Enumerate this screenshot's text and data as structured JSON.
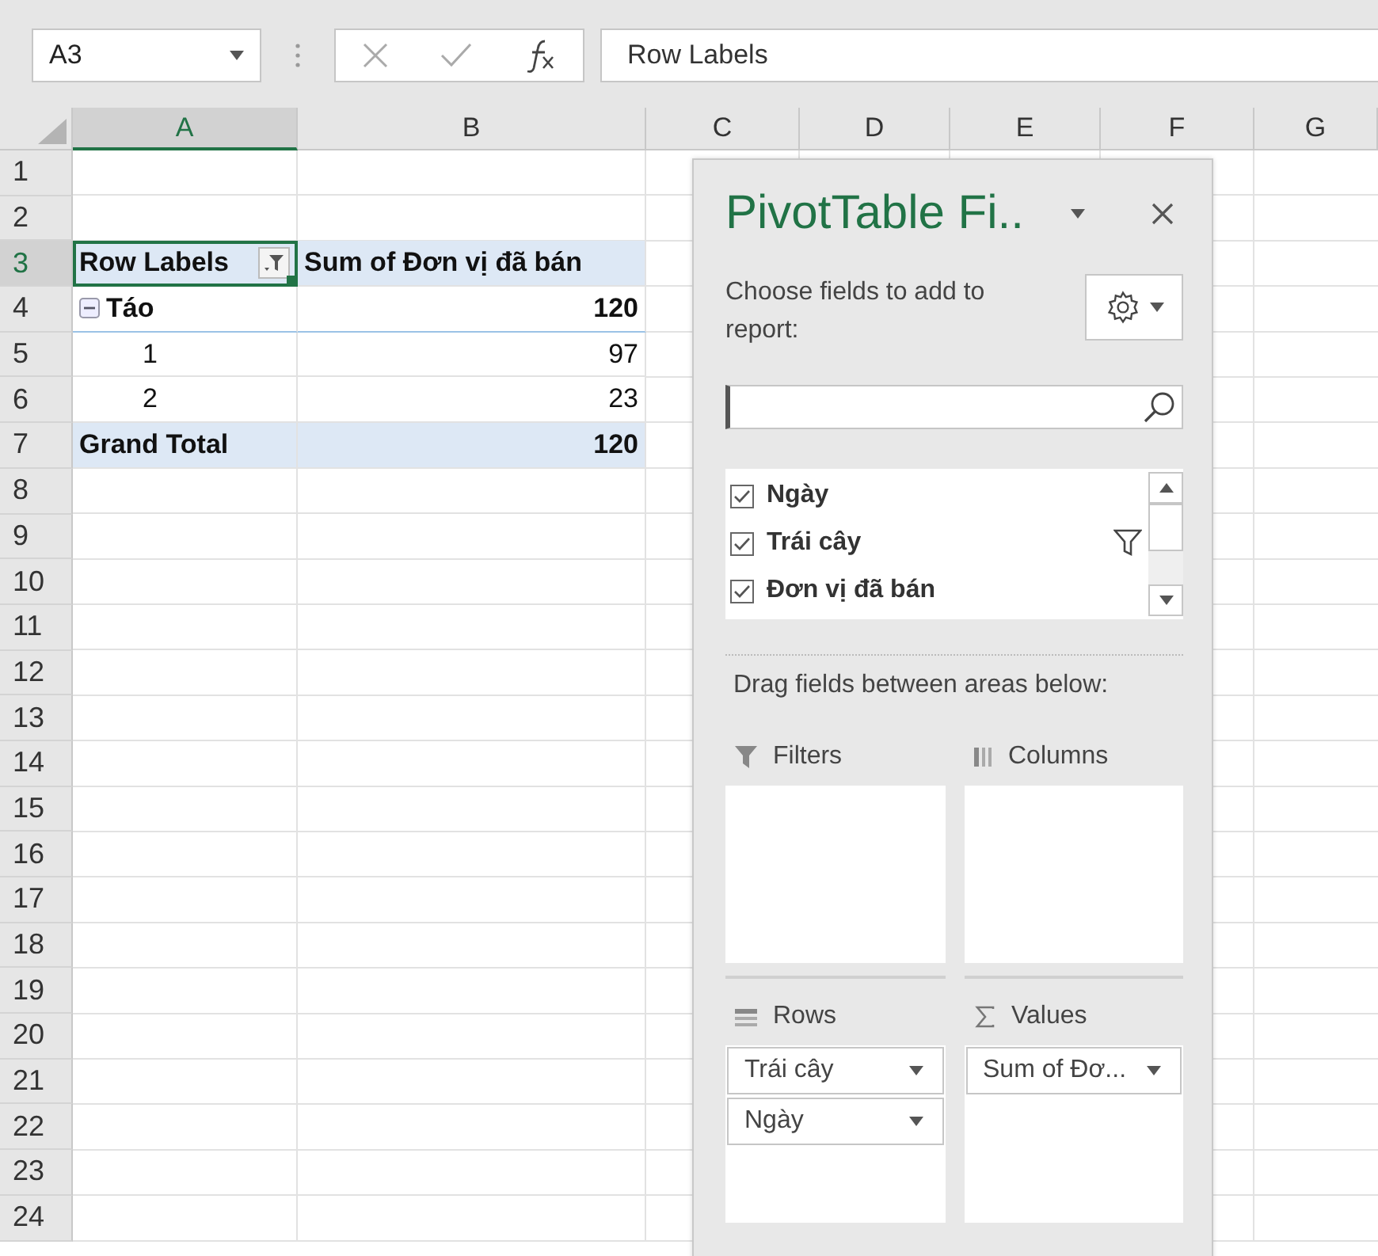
{
  "name_box": "A3",
  "formula": "Row Labels",
  "columns": [
    {
      "label": "A",
      "selected": true
    },
    {
      "label": "B",
      "selected": false
    },
    {
      "label": "C",
      "selected": false
    },
    {
      "label": "D",
      "selected": false
    },
    {
      "label": "E",
      "selected": false
    },
    {
      "label": "F",
      "selected": false
    },
    {
      "label": "G",
      "selected": false
    }
  ],
  "row_numbers": [
    {
      "label": "1",
      "selected": false
    },
    {
      "label": "2",
      "selected": false
    },
    {
      "label": "3",
      "selected": true
    },
    {
      "label": "4",
      "selected": false
    },
    {
      "label": "5",
      "selected": false
    },
    {
      "label": "6",
      "selected": false
    },
    {
      "label": "7",
      "selected": false
    },
    {
      "label": "8",
      "selected": false
    },
    {
      "label": "9",
      "selected": false
    },
    {
      "label": "10",
      "selected": false
    },
    {
      "label": "11",
      "selected": false
    },
    {
      "label": "12",
      "selected": false
    },
    {
      "label": "13",
      "selected": false
    },
    {
      "label": "14",
      "selected": false
    },
    {
      "label": "15",
      "selected": false
    },
    {
      "label": "16",
      "selected": false
    },
    {
      "label": "17",
      "selected": false
    },
    {
      "label": "18",
      "selected": false
    },
    {
      "label": "19",
      "selected": false
    },
    {
      "label": "20",
      "selected": false
    },
    {
      "label": "21",
      "selected": false
    },
    {
      "label": "22",
      "selected": false
    },
    {
      "label": "23",
      "selected": false
    },
    {
      "label": "24",
      "selected": false
    }
  ],
  "pivot_table": {
    "rows": [
      {
        "kind": "header",
        "label": "Row Labels",
        "value": "Sum of Đơn vị đã bán",
        "selected": true
      },
      {
        "kind": "group",
        "label": "Táo",
        "value": "120",
        "expanded": true
      },
      {
        "kind": "item",
        "label": "1",
        "value": "97"
      },
      {
        "kind": "item",
        "label": "2",
        "value": "23"
      },
      {
        "kind": "total",
        "label": "Grand Total",
        "value": "120"
      }
    ]
  },
  "field_list": {
    "title": "PivotTable Fi..",
    "instruction": "Choose fields to add to report:",
    "fields": [
      {
        "label": "Ngày",
        "checked": true,
        "filtered": false
      },
      {
        "label": "Trái cây",
        "checked": true,
        "filtered": true
      },
      {
        "label": "Đơn vị đã bán",
        "checked": true,
        "filtered": false
      }
    ],
    "areas_hint": "Drag fields between areas below:",
    "areas": [
      {
        "kind": "filters",
        "label": "Filters"
      },
      {
        "kind": "columns",
        "label": "Columns"
      },
      {
        "kind": "rows",
        "label": "Rows",
        "items": [
          "Trái cây",
          "Ngày"
        ]
      },
      {
        "kind": "values",
        "label": "Values",
        "items": [
          "Sum of Đơ..."
        ]
      }
    ]
  }
}
